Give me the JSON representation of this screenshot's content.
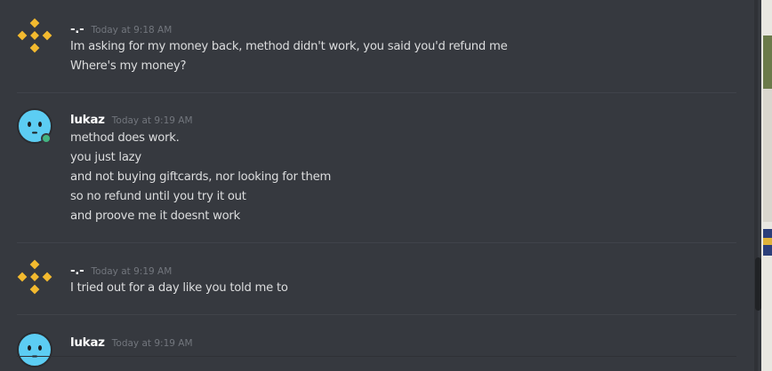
{
  "messages": [
    {
      "username": "-.-",
      "timestamp": "Today at 9:18 AM",
      "avatar_icon": "binance-logo-icon",
      "lines": [
        "Im asking for my money back, method didn't work, you said you'd refund me",
        "Where's my money?"
      ]
    },
    {
      "username": "lukaz",
      "timestamp": "Today at 9:19 AM",
      "avatar_icon": "smiley-face-icon",
      "online": true,
      "lines": [
        "method does work.",
        "you just lazy",
        "and not buying giftcards, nor looking for them",
        "so no refund until you try it out",
        "and proove me it doesnt work"
      ]
    },
    {
      "username": "-.-",
      "timestamp": "Today at 9:19 AM",
      "avatar_icon": "binance-logo-icon",
      "lines": [
        "I tried out for a day like you told me to"
      ]
    },
    {
      "username": "lukaz",
      "timestamp": "Today at 9:19 AM",
      "avatar_icon": "smiley-face-icon",
      "lines": []
    }
  ],
  "colors": {
    "background": "#36393f",
    "username": "#ffffff",
    "message_text": "#dcddde",
    "timestamp": "#72767d",
    "binance_yellow": "#f3ba2f",
    "avatar_blue": "#5ccdf3",
    "online_green": "#43b581"
  }
}
